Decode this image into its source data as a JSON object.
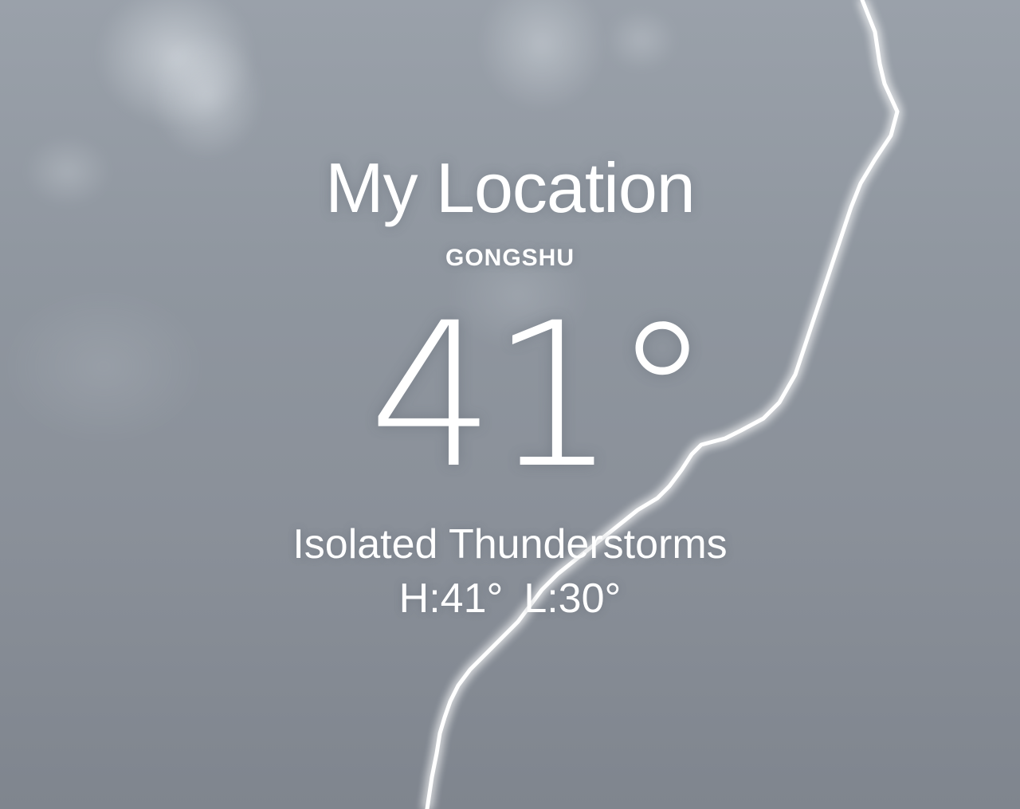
{
  "location": {
    "title": "My Location",
    "subtitle": "GONGSHU"
  },
  "current": {
    "temperature": "41°",
    "condition": "Isolated Thunderstorms",
    "high": "H:41°",
    "low": "L:30°"
  },
  "background": {
    "scene": "stormy-sky-with-lightning"
  },
  "colors": {
    "text": "#ffffff",
    "sky_top": "#9aa1aa",
    "sky_bottom": "#7f858e",
    "lightning": "#ffffff"
  }
}
